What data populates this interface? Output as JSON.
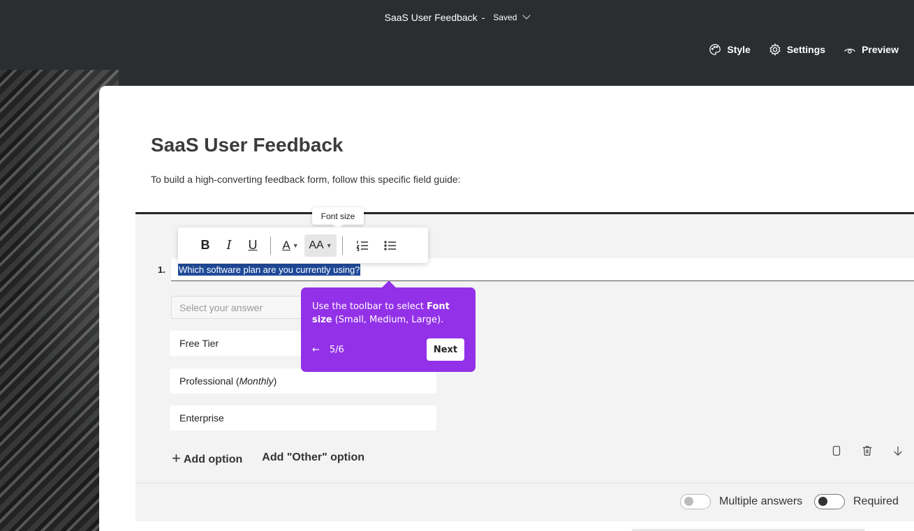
{
  "topbar": {
    "form_name": "SaaS User Feedback",
    "separator": "-",
    "status": "Saved"
  },
  "actions": {
    "style_label": "Style",
    "settings_label": "Settings",
    "preview_label": "Preview"
  },
  "form": {
    "title": "SaaS User Feedback",
    "description": "To build a high-converting feedback form, follow this specific field guide:"
  },
  "question": {
    "number": "1.",
    "text": "Which software plan are you currently using?",
    "placeholder": "Select your answer",
    "options": [
      {
        "label": "Free Tier"
      },
      {
        "label_prefix": "Professional (",
        "label_italic": "Monthly",
        "label_suffix": ")"
      },
      {
        "label": "Enterprise"
      }
    ],
    "add_option_label": "Add option",
    "add_other_label": "Add \"Other\" option",
    "multiple_answers_label": "Multiple answers",
    "multiple_answers_on": false,
    "required_label": "Required",
    "required_on": true
  },
  "toolbar": {
    "bold_label": "B",
    "italic_label": "I",
    "underline_label": "U",
    "font_color_glyph": "A",
    "font_size_glyph": "AA",
    "tooltip": "Font size"
  },
  "guide": {
    "text_before": "Use the toolbar to select ",
    "text_bold": "Font size",
    "text_after": " (Small, Medium, Large).",
    "back_arrow": "←",
    "step": "5/6",
    "next_label": "Next",
    "accent_color": "#9331e8"
  }
}
